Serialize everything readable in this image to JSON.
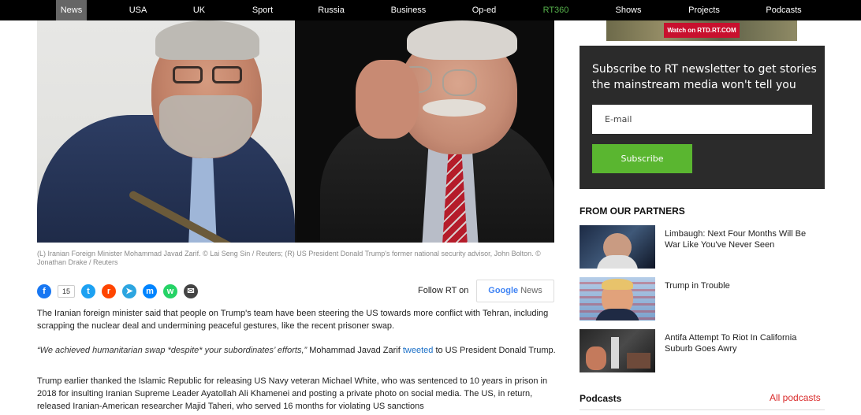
{
  "nav": {
    "items": [
      "News",
      "USA",
      "UK",
      "Sport",
      "Russia",
      "Business",
      "Op-ed",
      "RT360",
      "Shows",
      "Projects",
      "Podcasts"
    ],
    "active": "News"
  },
  "article": {
    "caption": "(L) Iranian Foreign Minister Mohammad Javad Zarif. © Lai Seng Sin / Reuters; (R) US President Donald Trump's former national security advisor, John Bolton. © Jonathan Drake / Reuters",
    "share_count": "15",
    "follow_label": "Follow RT on",
    "google_label": "Google",
    "news_label": "News",
    "para1": "The Iranian foreign minister said that people on Trump's team have been steering the US towards more conflict with Tehran, including scrapping the nuclear deal and undermining peaceful gestures, like the recent prisoner swap.",
    "quote": "“We achieved humanitarian swap *despite* your subordinates’ efforts,”",
    "quote_after": " Mohammad Javad Zarif ",
    "quote_link": "tweeted",
    "quote_end": " to US President Donald Trump.",
    "para3": "Trump earlier thanked the Islamic Republic for releasing US Navy veteran Michael White, who was sentenced to 10 years in prison in 2018 for insulting Iranian Supreme Leader Ayatollah Ali Khamenei and posting a private photo on social media. The US, in return, released Iranian-American researcher Majid Taheri, who served 16 months for violating US sanctions"
  },
  "sidebar": {
    "banner_text": "Watch on RTD.RT.COM",
    "newsletter": {
      "title": "Subscribe to RT newsletter to get stories the mainstream media won't tell you",
      "email_placeholder": "E-mail",
      "subscribe_label": "Subscribe"
    },
    "partners_title": "FROM OUR PARTNERS",
    "partners": [
      "Limbaugh: Next Four Months Will Be War Like You've Never Seen",
      "Trump in Trouble",
      "Antifa Attempt To Riot In California Suburb Goes Awry"
    ],
    "podcasts_title": "Podcasts",
    "podcasts_all": "All podcasts"
  },
  "colors": {
    "nav_bg": "#000000",
    "nav_active": "#666666",
    "rt360": "#56b14b",
    "subscribe": "#5ab630",
    "link_red": "#d92b2b",
    "facebook": "#1877f2",
    "twitter": "#1da1f2",
    "reddit": "#ff4500",
    "telegram": "#2ca5e0",
    "messenger": "#0084ff",
    "whatsapp": "#25d366",
    "email": "#444444"
  }
}
